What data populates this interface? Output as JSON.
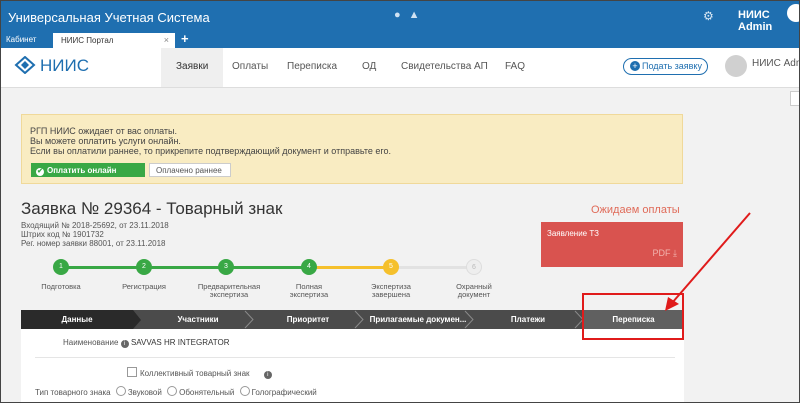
{
  "app": {
    "title": "Универсальная Учетная Система",
    "user": "НИИС Admin"
  },
  "browser_tabs": {
    "tab1": "Кабинет",
    "tab2": "НИИС Портал",
    "close": "×",
    "add": "+"
  },
  "brand": {
    "logo_text": "НИИС"
  },
  "nav": {
    "items": [
      {
        "label": "Заявки",
        "active": true
      },
      {
        "label": "Оплаты"
      },
      {
        "label": "Переписка"
      },
      {
        "label": "ОД"
      },
      {
        "label": "Свидетельства АП"
      },
      {
        "label": "FAQ"
      }
    ],
    "submit_label": "Подать заявку",
    "user_label": "НИИС Admin"
  },
  "notice": {
    "line1": "РГП НИИС ожидает от вас оплаты.",
    "line2": "Вы можете оплатить услуги онлайн.",
    "line3": "Если вы оплатили раннее, то прикрепите подтверждающий документ и отправьте его.",
    "pay_online": "Оплатить онлайн",
    "paid_earlier": "Оплачено раннее"
  },
  "application": {
    "title": "Заявка № 29364 - Товарный знак",
    "incoming": "Входящий № 2018-25692, от 23.11.2018",
    "barcode": "Штрих код № 1901732",
    "reg_number": "Рег. номер заявки 88001, от 23.11.2018",
    "status": "Ожидаем оплаты",
    "statement_label": "Заявление ТЗ",
    "pdf_label": "PDF ⤓"
  },
  "steps": [
    {
      "num": "1",
      "l1": "Подготовка",
      "l2": ""
    },
    {
      "num": "2",
      "l1": "Регистрация",
      "l2": ""
    },
    {
      "num": "3",
      "l1": "Предварительная",
      "l2": "экспертиза"
    },
    {
      "num": "4",
      "l1": "Полная",
      "l2": "экспертиза"
    },
    {
      "num": "5",
      "l1": "Экспертиза",
      "l2": "завершена"
    },
    {
      "num": "6",
      "l1": "Охранный",
      "l2": "документ"
    }
  ],
  "tabs": [
    "Данные",
    "Участники",
    "Приоритет",
    "Прилагаемые докумен...",
    "Платежи",
    "Переписка"
  ],
  "form": {
    "name_label": "Наименование",
    "name_value": "SAVVAS HR INTEGRATOR",
    "collective_label": "Коллективный товарный знак",
    "type_label": "Тип товарного знака",
    "type_options": [
      "Звуковой",
      "Обонятельный",
      "Голографический"
    ]
  },
  "colors": {
    "primary": "#1f6fb0",
    "done": "#39a845",
    "current": "#f5c02c",
    "pending": "#dddddd",
    "alert": "#d9534f",
    "highlight": "#e01b1b"
  }
}
